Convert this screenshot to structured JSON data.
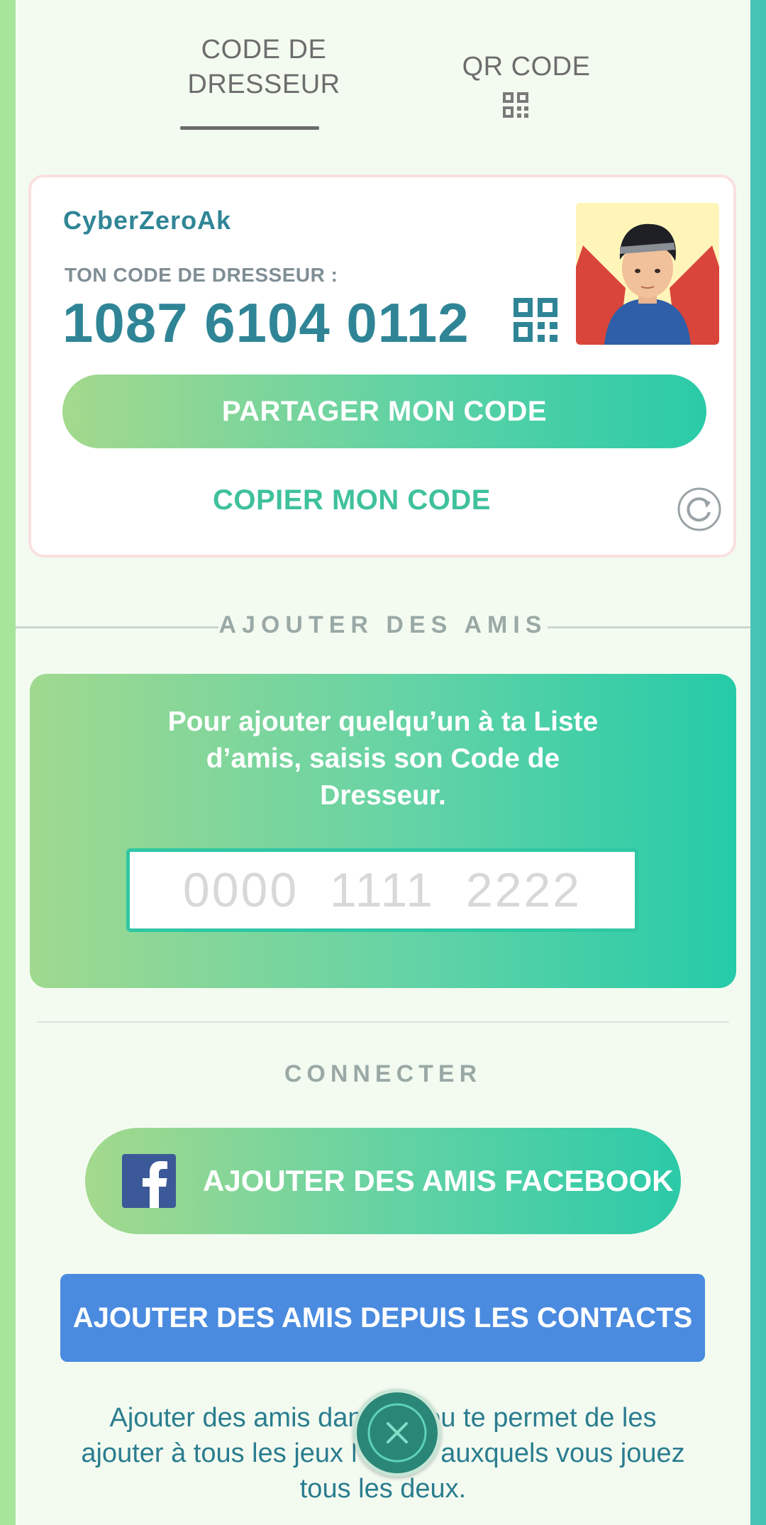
{
  "tabs": {
    "trainer_code_line1": "CODE DE",
    "trainer_code_line2": "DRESSEUR",
    "qr_code": "QR CODE"
  },
  "card": {
    "username": "CyberZeroAk",
    "code_label": "TON CODE DE DRESSEUR :",
    "code_value": "1087 6104 0112",
    "share_button": "PARTAGER MON CODE",
    "copy_button": "COPIER MON CODE"
  },
  "add_friends": {
    "section_title": "AJOUTER DES AMIS",
    "description": "Pour ajouter quelqu’un à ta Liste d’amis, saisis son Code de Dresseur.",
    "input_placeholder": "0000  1111  2222"
  },
  "connect": {
    "section_title": "CONNECTER",
    "facebook_button": "AJOUTER DES AMIS FACEBOOK",
    "contacts_button": "AJOUTER DES AMIS DEPUIS LES CONTACTS",
    "footer_text": "Ajouter des amis dans ce jeu te permet de les ajouter à tous les jeux Niantic auxquels vous jouez tous les deux."
  },
  "colors": {
    "accent_teal": "#2f8596",
    "accent_green": "#3fc19c",
    "contacts_blue": "#4a8be0",
    "facebook_blue": "#3b5998"
  },
  "icons": [
    "qr-code-icon",
    "refresh-icon",
    "facebook-icon",
    "close-icon"
  ]
}
